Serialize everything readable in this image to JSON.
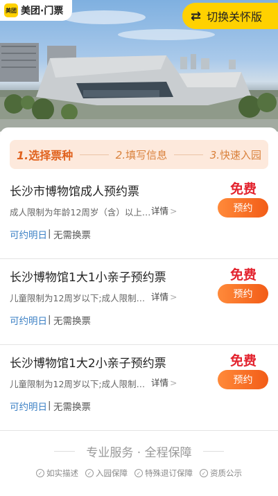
{
  "header": {
    "logo_mark": "美团",
    "logo_text": "美团·门票",
    "care_mode_label": "切换关怀版"
  },
  "steps": [
    {
      "num": "1.",
      "label": "选择票种"
    },
    {
      "num": "2.",
      "label": "填写信息"
    },
    {
      "num": "3.",
      "label": "快速入园"
    }
  ],
  "tickets": [
    {
      "title": "长沙市博物馆成人预约票",
      "desc": "成人限制为年龄12周岁（含）以上…",
      "detail": "详情",
      "book_time": "可约明日",
      "separator": "|",
      "exchange": "无需换票",
      "price": "免费",
      "button": "预约"
    },
    {
      "title": "长沙博物馆1大1小亲子预约票",
      "desc": "儿童限制为12周岁以下;成人限制…",
      "detail": "详情",
      "book_time": "可约明日",
      "separator": "|",
      "exchange": "无需换票",
      "price": "免费",
      "button": "预约"
    },
    {
      "title": "长沙博物馆1大2小亲子预约票",
      "desc": "儿童限制为12周岁以下;成人限制…",
      "detail": "详情",
      "book_time": "可约明日",
      "separator": "|",
      "exchange": "无需换票",
      "price": "免费",
      "button": "预约"
    }
  ],
  "guarantee": {
    "title": "专业服务 · 全程保障",
    "items": [
      "如实描述",
      "入园保障",
      "特殊退订保障",
      "资质公示"
    ]
  },
  "colors": {
    "brand_yellow": "#ffd100",
    "accent_orange": "#f25c17",
    "price_red": "#e3232e",
    "link_blue": "#3a7fc4"
  }
}
